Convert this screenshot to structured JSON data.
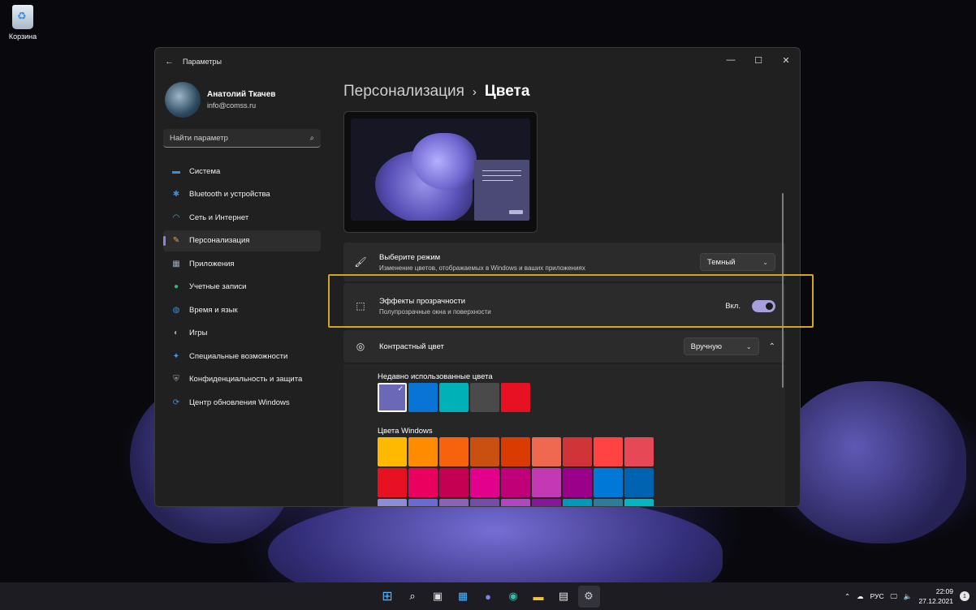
{
  "desktop": {
    "recycle_bin_label": "Корзина"
  },
  "window": {
    "title": "Параметры",
    "controls": [
      "minimize-icon",
      "maximize-icon",
      "close-icon"
    ]
  },
  "profile": {
    "name": "Анатолий Ткачев",
    "email": "info@comss.ru"
  },
  "search": {
    "placeholder": "Найти параметр"
  },
  "sidebar": {
    "items": [
      {
        "label": "Система",
        "icon": "system-icon",
        "color": "#3b8fd9"
      },
      {
        "label": "Bluetooth и устройства",
        "icon": "bluetooth-icon",
        "color": "#3b8fd9"
      },
      {
        "label": "Сеть и Интернет",
        "icon": "wifi-icon",
        "color": "#4aa9e8"
      },
      {
        "label": "Персонализация",
        "icon": "brush-icon",
        "color": "#e0a060",
        "active": true
      },
      {
        "label": "Приложения",
        "icon": "apps-icon",
        "color": "#9aa5b5"
      },
      {
        "label": "Учетные записи",
        "icon": "account-icon",
        "color": "#2fb879"
      },
      {
        "label": "Время и язык",
        "icon": "globe-icon",
        "color": "#3b8fd9"
      },
      {
        "label": "Игры",
        "icon": "gamepad-icon",
        "color": "#9aa5b5"
      },
      {
        "label": "Специальные возможности",
        "icon": "accessibility-icon",
        "color": "#3b9ee8"
      },
      {
        "label": "Конфиденциальность и защита",
        "icon": "shield-icon",
        "color": "#9aa5b5"
      },
      {
        "label": "Центр обновления Windows",
        "icon": "update-icon",
        "color": "#3b8fd9"
      }
    ]
  },
  "breadcrumb": {
    "parent": "Персонализация",
    "separator": "›",
    "current": "Цвета"
  },
  "mode_card": {
    "title": "Выберите режим",
    "subtitle": "Изменение цветов, отображаемых в Windows и ваших приложениях",
    "value": "Темный"
  },
  "transparency_card": {
    "title": "Эффекты прозрачности",
    "subtitle": "Полупрозрачные окна и поверхности",
    "state_label": "Вкл.",
    "enabled": true
  },
  "accent_card": {
    "title": "Контрастный цвет",
    "value": "Вручную"
  },
  "recent_colors": {
    "label": "Недавно использованные цвета",
    "colors": [
      "#6b69b7",
      "#0a73d6",
      "#00b2b7",
      "#4a4a4a",
      "#e81123"
    ],
    "selected_index": 0
  },
  "windows_colors": {
    "label": "Цвета Windows",
    "rows": [
      [
        "#ffb900",
        "#ff8c00",
        "#f7630c",
        "#ca5010",
        "#da3b01",
        "#ef6950",
        "#d13438",
        "#ff4343",
        "#e74856"
      ],
      [
        "#e81123",
        "#ea005e",
        "#c30052",
        "#e3008c",
        "#bf0077",
        "#c239b3",
        "#9a0089",
        "#0078d7",
        "#0063b1"
      ],
      [
        "#8e8cd8",
        "#6b69d6",
        "#8764b8",
        "#744da9",
        "#b146c2",
        "#881798",
        "#0099bc",
        "#2d7d9a",
        "#00b7c3"
      ]
    ]
  },
  "taskbar": {
    "icons": [
      "windows-start-icon",
      "search-icon",
      "task-view-icon",
      "widgets-icon",
      "chat-icon",
      "edge-icon",
      "explorer-icon",
      "store-icon",
      "settings-icon"
    ],
    "tray": {
      "language": "РУС",
      "time": "22:09",
      "date": "27.12.2021",
      "notifications": "1"
    }
  }
}
